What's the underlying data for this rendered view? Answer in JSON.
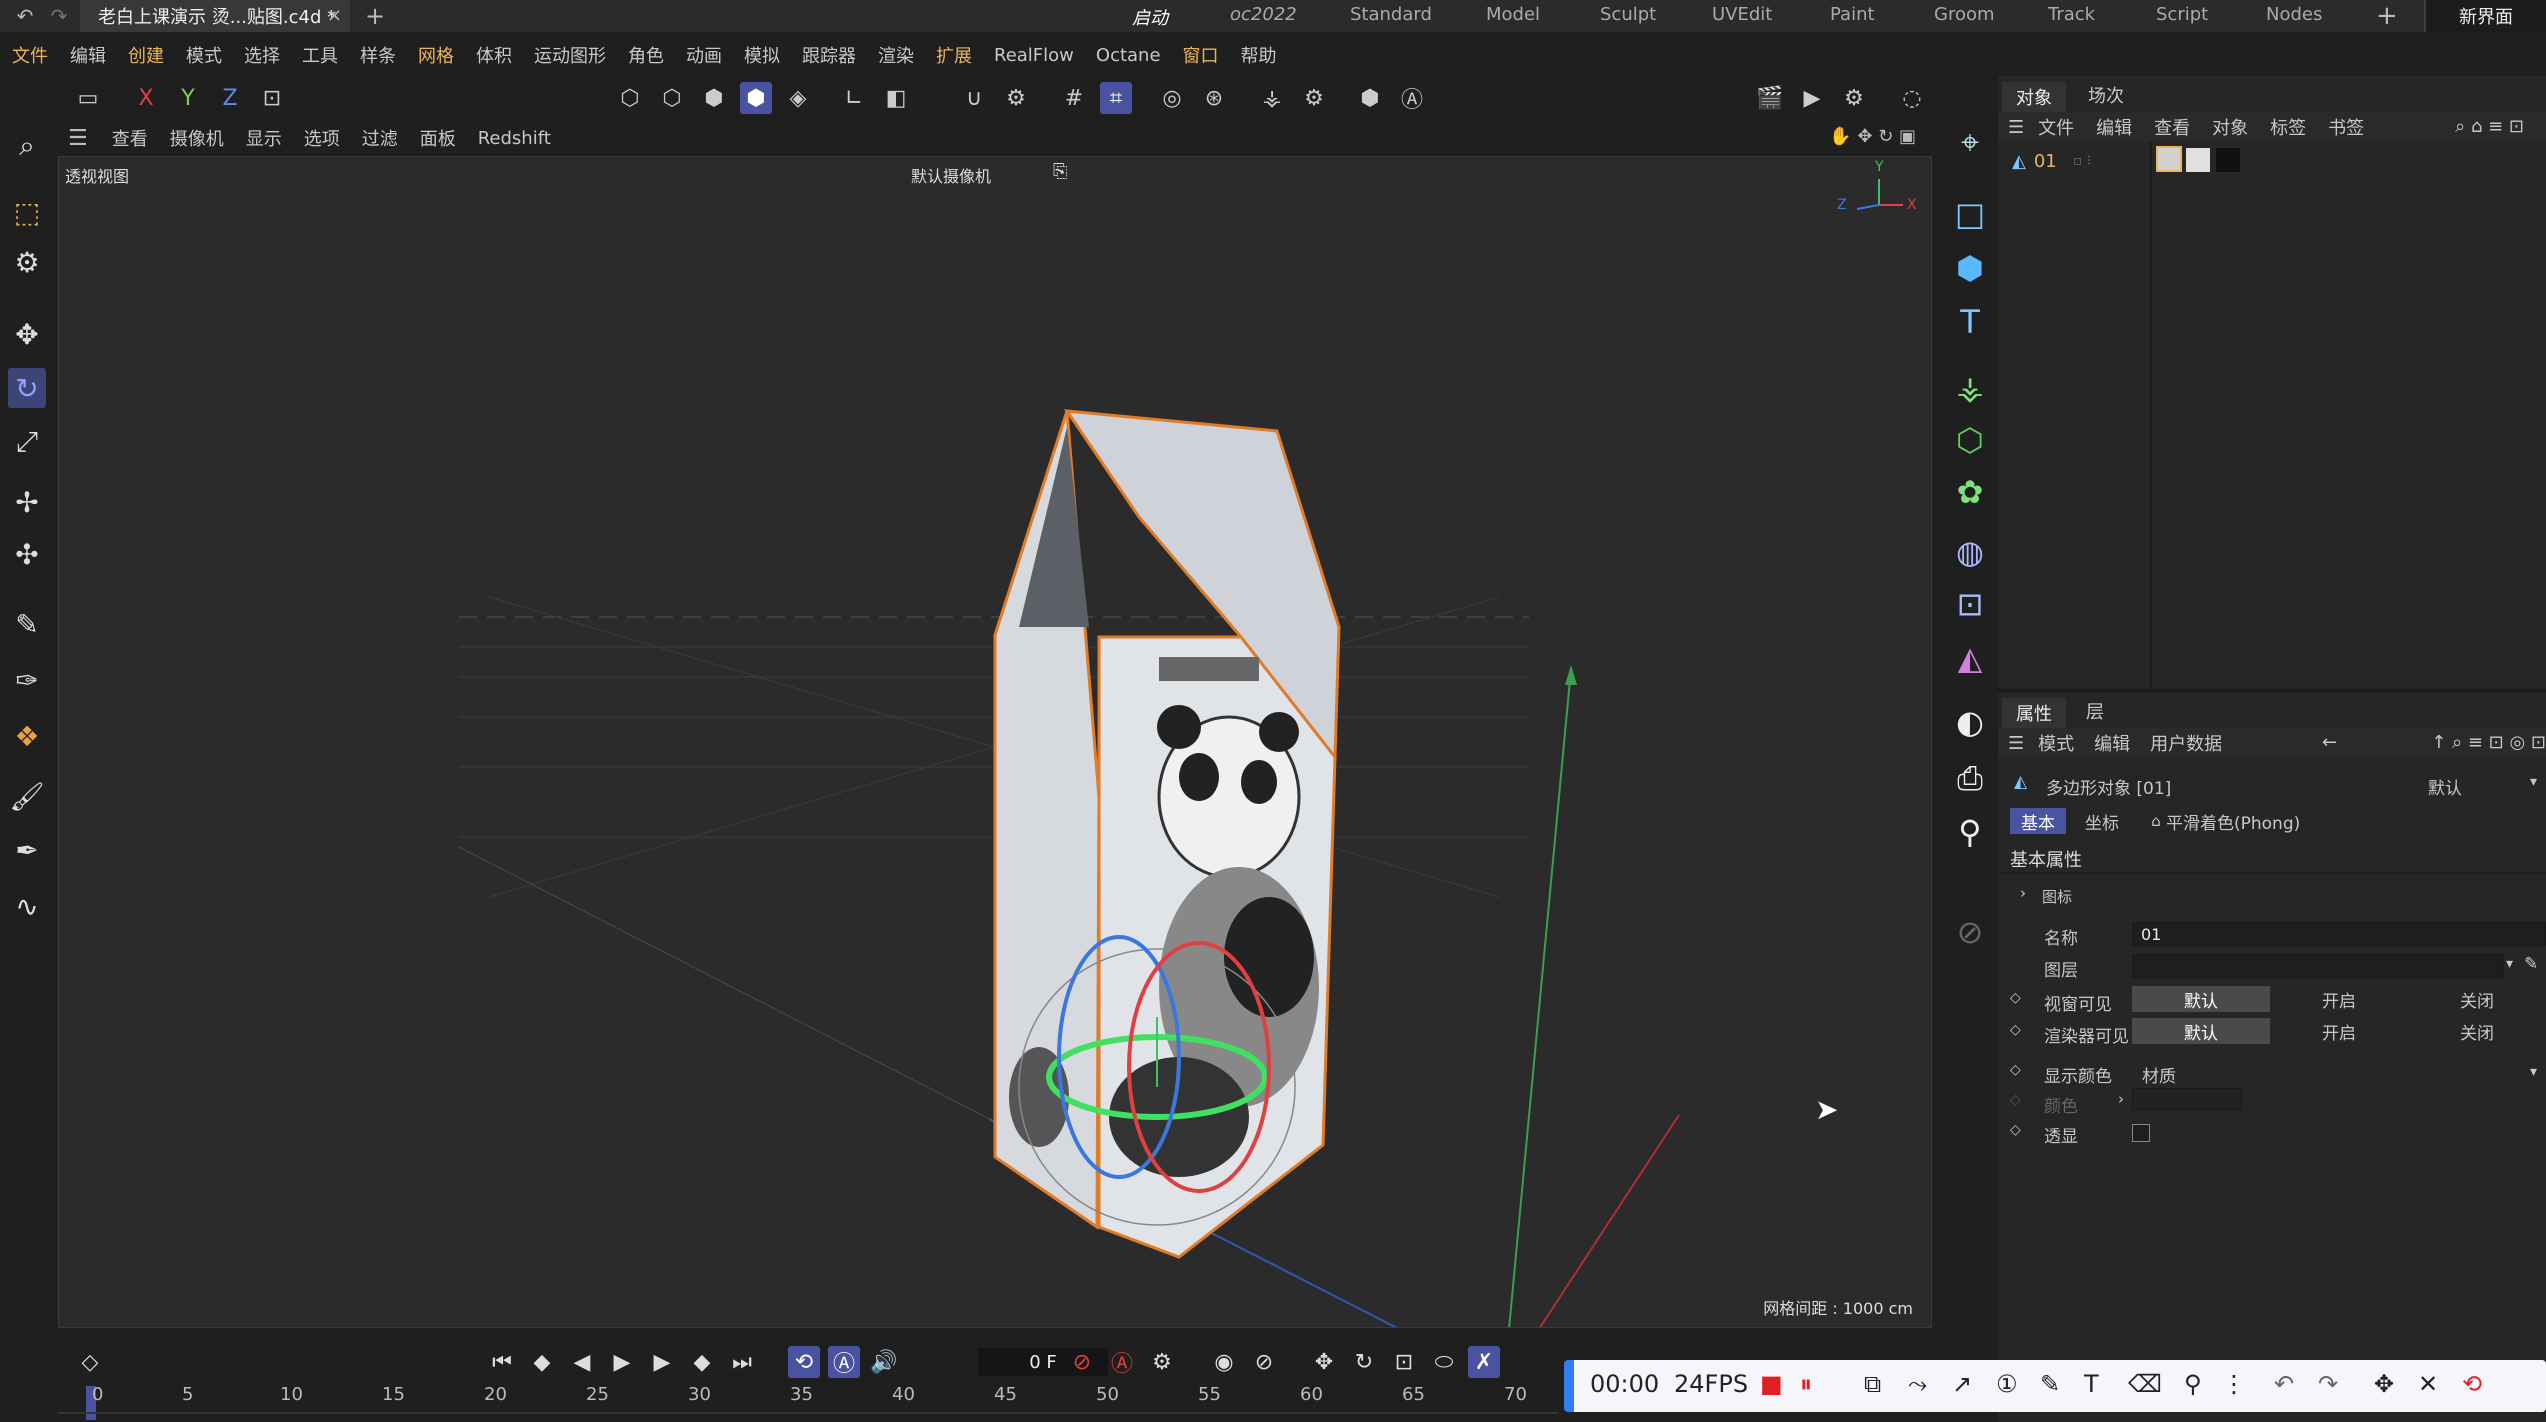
{
  "titlebar": {
    "document_tab": "老白上课演示 烫...贴图.c4d *",
    "close_glyph": "×",
    "new_tab_glyph": "+",
    "layouts": [
      "启动",
      "oc2022",
      "Standard",
      "Model",
      "Sculpt",
      "UVEdit",
      "Paint",
      "Groom",
      "Track",
      "Script",
      "Nodes"
    ],
    "active_layout": "启动",
    "layout_add": "+",
    "new_ui": "新界面"
  },
  "menubar": {
    "items": [
      "文件",
      "编辑",
      "创建",
      "模式",
      "选择",
      "工具",
      "样条",
      "网格",
      "体积",
      "运动图形",
      "角色",
      "动画",
      "模拟",
      "跟踪器",
      "渲染",
      "扩展",
      "RealFlow",
      "Octane",
      "窗口",
      "帮助"
    ],
    "highlighted": [
      "文件",
      "创建",
      "网格",
      "扩展",
      "窗口"
    ]
  },
  "toolbar": {
    "axis_x": "X",
    "axis_y": "Y",
    "axis_z": "Z"
  },
  "viewport": {
    "menu": [
      "查看",
      "摄像机",
      "显示",
      "选项",
      "过滤",
      "面板",
      "Redshift"
    ],
    "view_name": "透视视图",
    "camera_name": "默认摄像机",
    "grid_spacing": "网格间距 : 1000 cm",
    "axis_labels": {
      "y": "Y",
      "z": "Z",
      "x": "X"
    }
  },
  "object_manager": {
    "tabs": [
      "对象",
      "场次"
    ],
    "menu": [
      "文件",
      "编辑",
      "查看",
      "对象",
      "标签",
      "书签"
    ],
    "objects": [
      {
        "name": "01"
      }
    ]
  },
  "attributes": {
    "tabs": [
      "属性",
      "层"
    ],
    "menu": [
      "模式",
      "编辑",
      "用户数据"
    ],
    "object_title": "多边形对象 [01]",
    "preset": "默认",
    "subtabs": [
      "基本",
      "坐标",
      "平滑着色(Phong)"
    ],
    "section": "基本属性",
    "icon_group": "图标",
    "fields": {
      "name_label": "名称",
      "name_value": "01",
      "layer_label": "图层",
      "editor_visible_label": "视窗可见",
      "render_visible_label": "渲染器可见",
      "vis_options": [
        "默认",
        "开启",
        "关闭"
      ],
      "display_color_label": "显示颜色",
      "display_color_value": "材质",
      "color_label": "颜色",
      "xray_label": "透显"
    }
  },
  "timeline": {
    "frame": "0 F",
    "ruler": [
      "0",
      "5",
      "10",
      "15",
      "20",
      "25",
      "30",
      "35",
      "40",
      "45",
      "50",
      "55",
      "60",
      "65",
      "70"
    ]
  },
  "recorder": {
    "time": "00:00",
    "fps": "24FPS"
  },
  "colors": {
    "accent": "#4a53a0",
    "menu_highlight": "#e8b65a",
    "selection_outline": "#e07b28",
    "axis_x": "#e04040",
    "axis_y": "#40c060",
    "axis_z": "#3a78e0",
    "recorder_blue": "#2e7ef5"
  }
}
